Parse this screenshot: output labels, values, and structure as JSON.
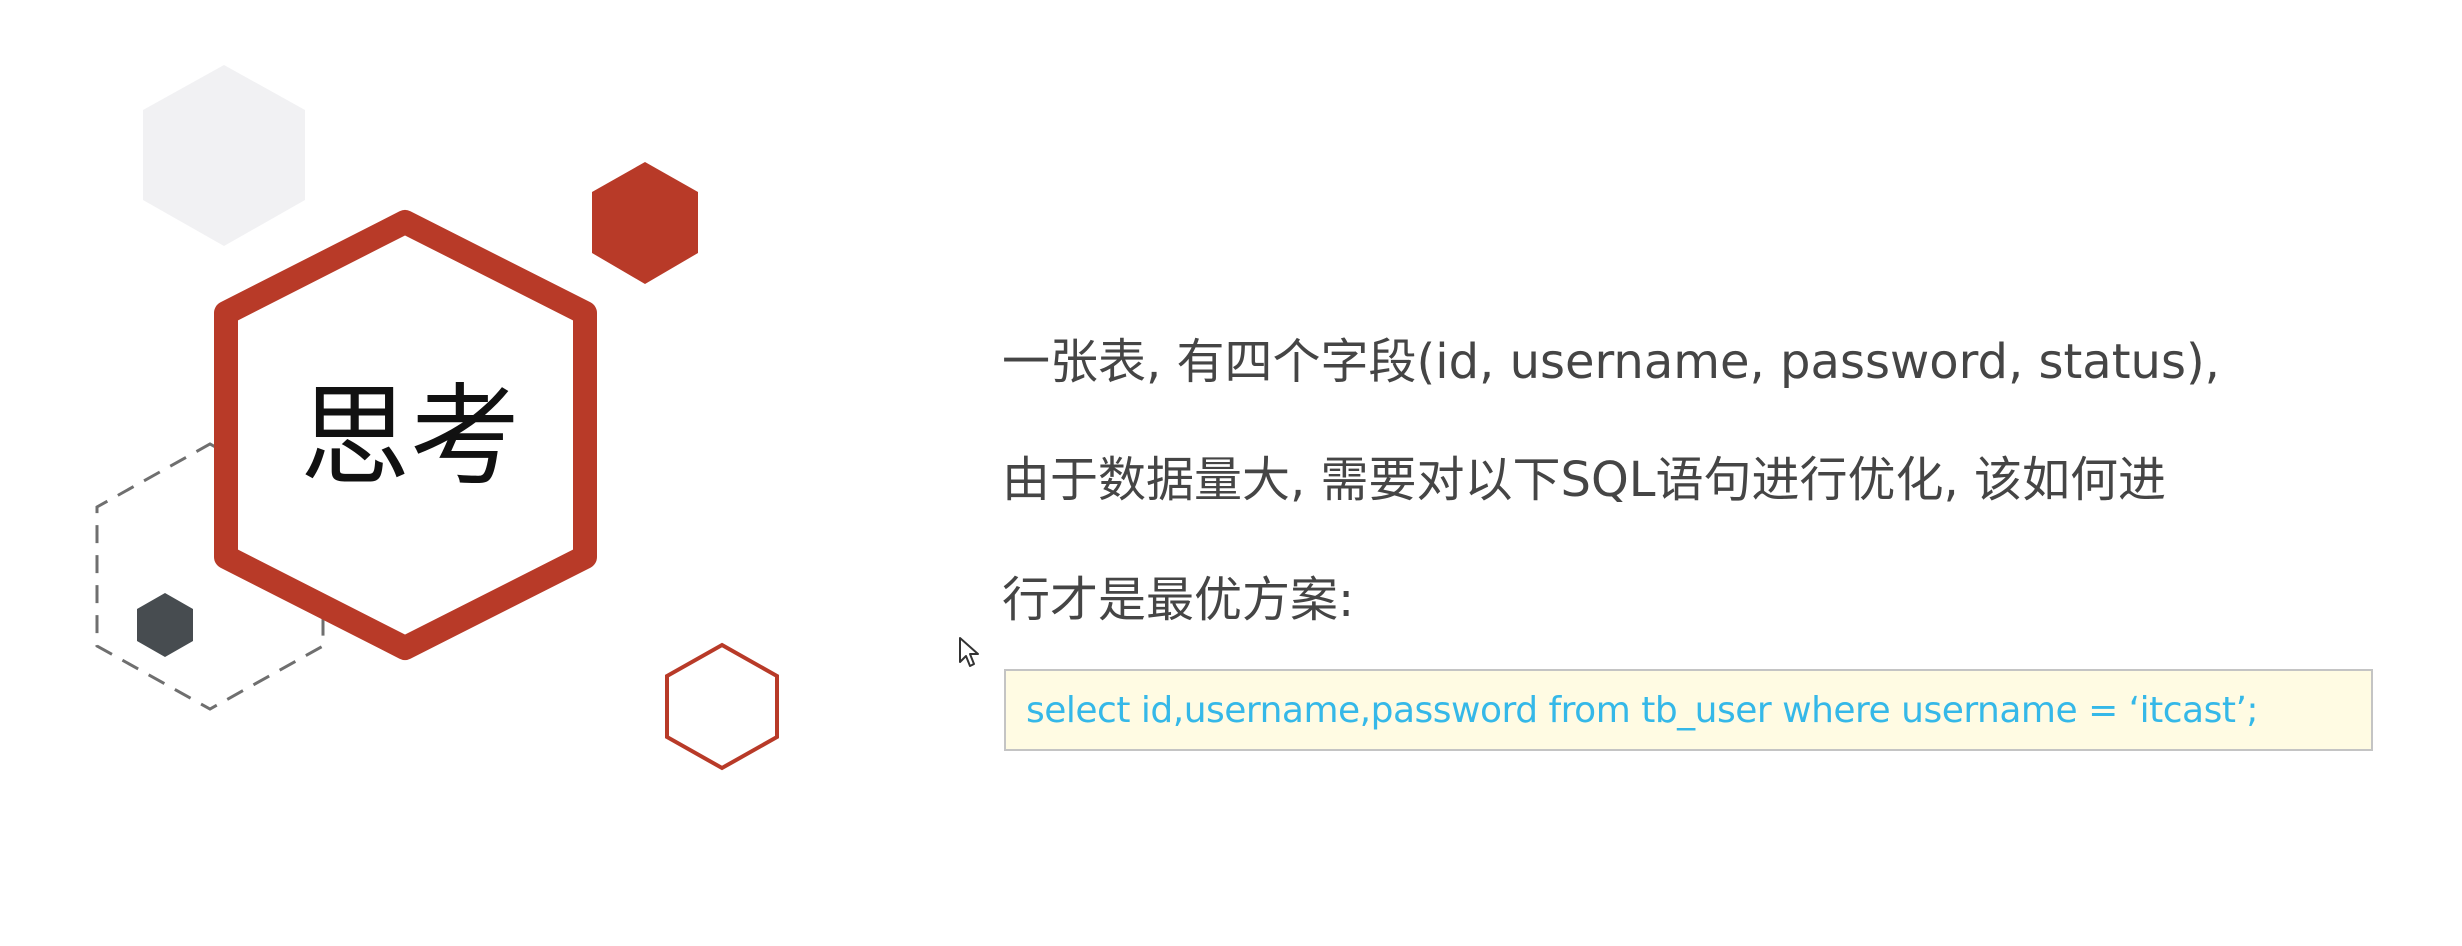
{
  "slide": {
    "title": "思考",
    "question_lines": [
      "一张表, 有四个字段(id, username, password, status),",
      "由于数据量大, 需要对以下SQL语句进行优化, 该如何进",
      "行才是最优方案:"
    ],
    "sql_code": "select  id,username,password  from  tb_user  where  username = ‘itcast’;"
  },
  "colors": {
    "accent_red": "#b83a28",
    "dark_gray": "#474c50",
    "light_gray": "#f1f1f3",
    "code_text": "#35b8e8",
    "code_background": "#fffbe3",
    "body_text": "#454545"
  },
  "icons": [
    "mouse-pointer-icon"
  ]
}
